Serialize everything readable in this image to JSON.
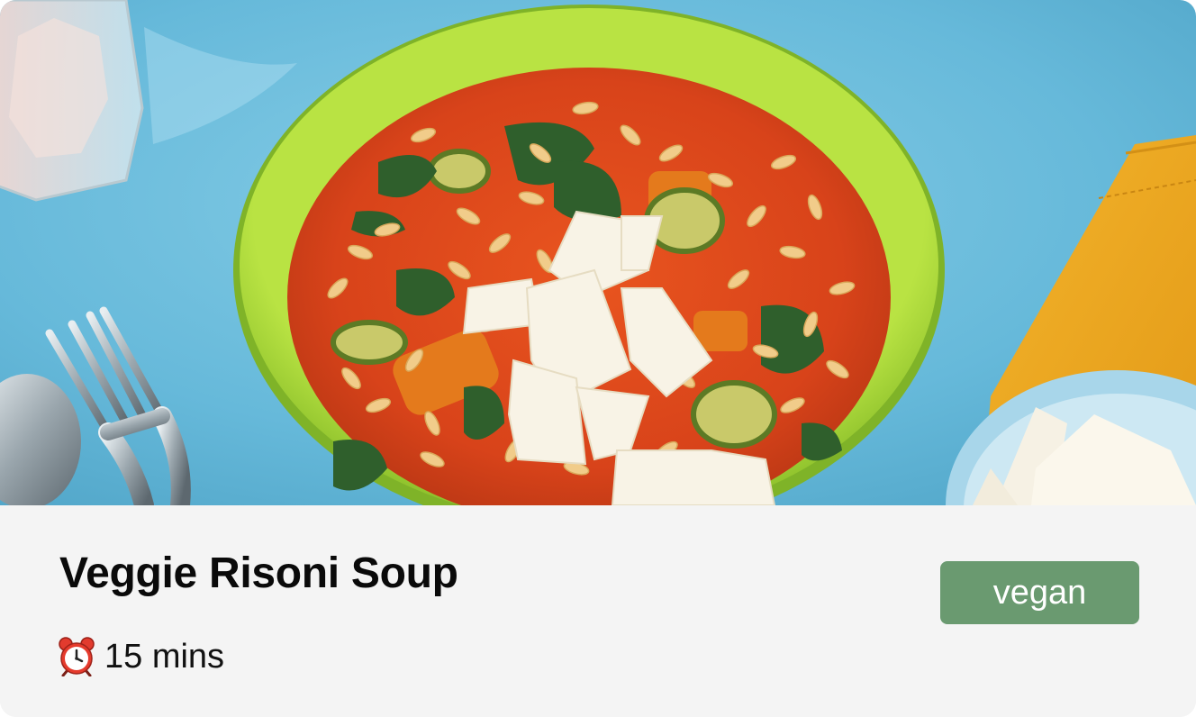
{
  "card": {
    "image_alt": "Veggie Risoni Soup",
    "title": "Veggie Risoni Soup",
    "cook_time": "15 mins",
    "time_icon": "alarm-clock-icon",
    "tag": {
      "label": "vegan",
      "color": "#6a9a70"
    }
  },
  "colors": {
    "background_table": "#64b8d8",
    "bowl_rim": "#a8d83a",
    "soup": "#d7421a",
    "napkin": "#efaa22",
    "info_panel": "#f4f4f4"
  }
}
